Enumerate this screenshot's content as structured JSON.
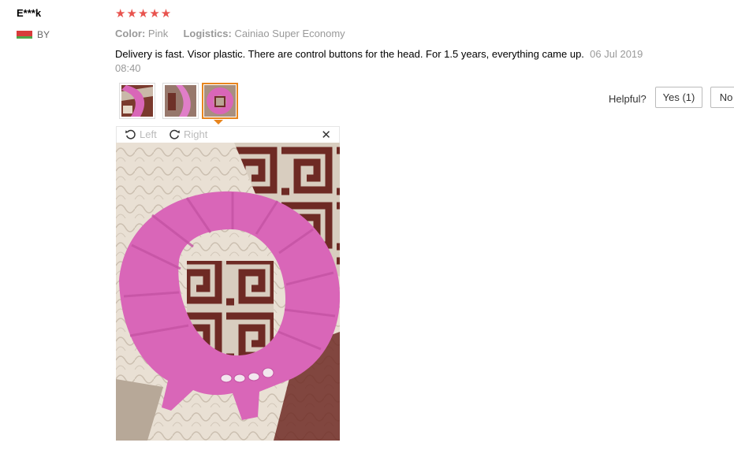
{
  "reviewer": {
    "name": "E***k",
    "country_code": "BY"
  },
  "rating": {
    "stars": 5,
    "glyphs": "★★★★★"
  },
  "meta": {
    "color_label": "Color:",
    "color_value": "Pink",
    "logistics_label": "Logistics:",
    "logistics_value": "Cainiao Super Economy"
  },
  "review": {
    "text": "Delivery is fast. Visor plastic. There are control buttons for the head. For 1.5 years, everything came up.",
    "date": "06 Jul 2019 08:40"
  },
  "helpful": {
    "label": "Helpful?",
    "yes_label": "Yes (1)",
    "no_label": "No"
  },
  "viewer": {
    "left_label": "Left",
    "right_label": "Right",
    "close_glyph": "✕"
  },
  "colors": {
    "star": "#e8534e",
    "active_thumb": "#e8851e",
    "visor_pink": "#d966b8"
  },
  "icons": [
    "rotate-left-icon",
    "rotate-right-icon",
    "close-icon",
    "flag-icon",
    "star-icon"
  ]
}
